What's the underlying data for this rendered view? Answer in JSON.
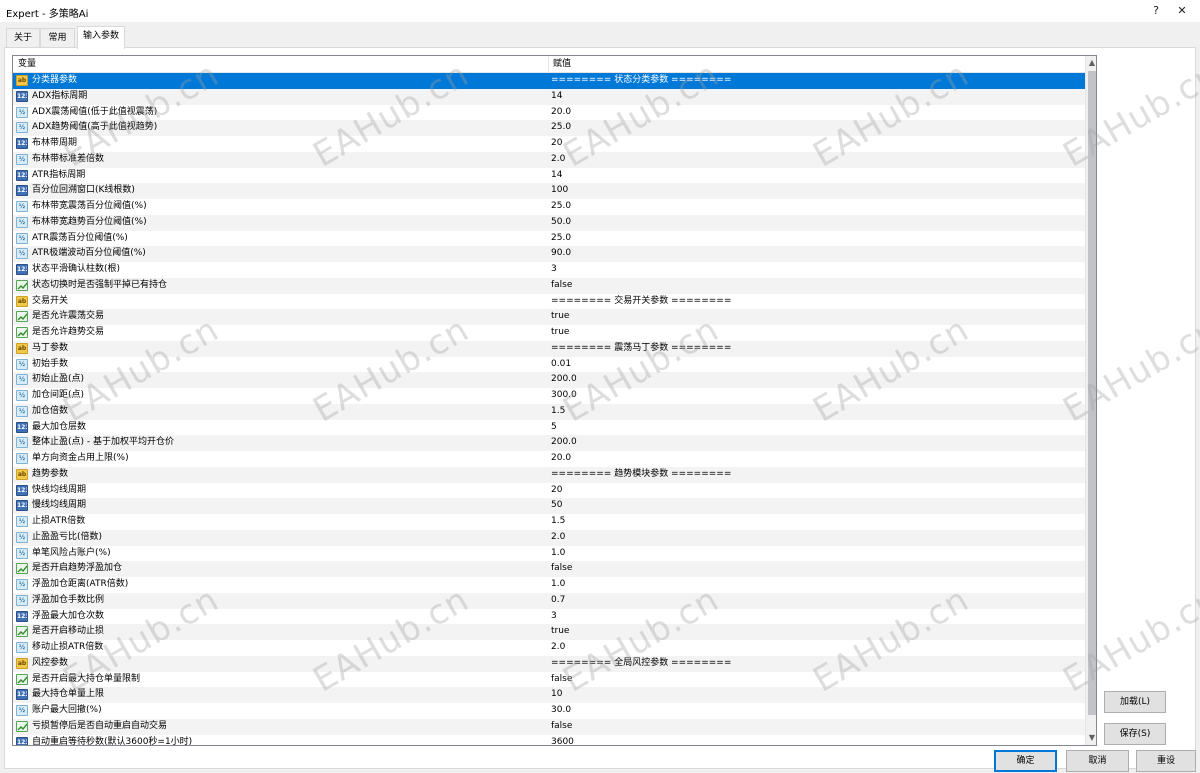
{
  "window": {
    "title": "Expert - 多策略Ai",
    "help_label": "?",
    "close_label": "✕"
  },
  "tabs": [
    {
      "label": "关于",
      "active": false
    },
    {
      "label": "常用",
      "active": false
    },
    {
      "label": "输入参数",
      "active": true
    }
  ],
  "table": {
    "col_variable": "变量",
    "col_value": "赋值",
    "rows": [
      {
        "type": "string",
        "name": "分类器参数",
        "value": "======== 状态分类参数 ========",
        "selected": true
      },
      {
        "type": "int",
        "name": "ADX指标周期",
        "value": "14"
      },
      {
        "type": "double",
        "name": "ADX震荡阈值(低于此值视震荡)",
        "value": "20.0"
      },
      {
        "type": "double",
        "name": "ADX趋势阈值(高于此值视趋势)",
        "value": "25.0"
      },
      {
        "type": "int",
        "name": "布林带周期",
        "value": "20"
      },
      {
        "type": "double",
        "name": "布林带标准差倍数",
        "value": "2.0"
      },
      {
        "type": "int",
        "name": "ATR指标周期",
        "value": "14"
      },
      {
        "type": "int",
        "name": "百分位回溯窗口(K线根数)",
        "value": "100"
      },
      {
        "type": "double",
        "name": "布林带宽震荡百分位阈值(%)",
        "value": "25.0"
      },
      {
        "type": "double",
        "name": "布林带宽趋势百分位阈值(%)",
        "value": "50.0"
      },
      {
        "type": "double",
        "name": "ATR震荡百分位阈值(%)",
        "value": "25.0"
      },
      {
        "type": "double",
        "name": "ATR极端波动百分位阈值(%)",
        "value": "90.0"
      },
      {
        "type": "int",
        "name": "状态平滑确认柱数(根)",
        "value": "3"
      },
      {
        "type": "bool",
        "name": "状态切换时是否强制平掉已有持仓",
        "value": "false"
      },
      {
        "type": "string",
        "name": "交易开关",
        "value": "======== 交易开关参数 ========"
      },
      {
        "type": "bool",
        "name": "是否允许震荡交易",
        "value": "true"
      },
      {
        "type": "bool",
        "name": "是否允许趋势交易",
        "value": "true"
      },
      {
        "type": "string",
        "name": "马丁参数",
        "value": "======== 震荡马丁参数 ========"
      },
      {
        "type": "double",
        "name": "初始手数",
        "value": "0.01"
      },
      {
        "type": "double",
        "name": "初始止盈(点)",
        "value": "200.0"
      },
      {
        "type": "double",
        "name": "加仓间距(点)",
        "value": "300.0"
      },
      {
        "type": "double",
        "name": "加仓倍数",
        "value": "1.5"
      },
      {
        "type": "int",
        "name": "最大加仓层数",
        "value": "5"
      },
      {
        "type": "double",
        "name": "整体止盈(点) - 基于加权平均开仓价",
        "value": "200.0"
      },
      {
        "type": "double",
        "name": "单方向资金占用上限(%)",
        "value": "20.0"
      },
      {
        "type": "string",
        "name": "趋势参数",
        "value": "======== 趋势模块参数 ========"
      },
      {
        "type": "int",
        "name": "快线均线周期",
        "value": "20"
      },
      {
        "type": "int",
        "name": "慢线均线周期",
        "value": "50"
      },
      {
        "type": "double",
        "name": "止损ATR倍数",
        "value": "1.5"
      },
      {
        "type": "double",
        "name": "止盈盈亏比(倍数)",
        "value": "2.0"
      },
      {
        "type": "double",
        "name": "单笔风险占账户(%)",
        "value": "1.0"
      },
      {
        "type": "bool",
        "name": "是否开启趋势浮盈加仓",
        "value": "false"
      },
      {
        "type": "double",
        "name": "浮盈加仓距离(ATR倍数)",
        "value": "1.0"
      },
      {
        "type": "double",
        "name": "浮盈加仓手数比例",
        "value": "0.7"
      },
      {
        "type": "int",
        "name": "浮盈最大加仓次数",
        "value": "3"
      },
      {
        "type": "bool",
        "name": "是否开启移动止损",
        "value": "true"
      },
      {
        "type": "double",
        "name": "移动止损ATR倍数",
        "value": "2.0"
      },
      {
        "type": "string",
        "name": "风控参数",
        "value": "======== 全局风控参数 ========"
      },
      {
        "type": "bool",
        "name": "是否开启最大持仓单量限制",
        "value": "false"
      },
      {
        "type": "int",
        "name": "最大持仓单量上限",
        "value": "10"
      },
      {
        "type": "double",
        "name": "账户最大回撤(%)",
        "value": "30.0"
      },
      {
        "type": "bool",
        "name": "亏损暂停后是否自动重启自动交易",
        "value": "false"
      },
      {
        "type": "int",
        "name": "自动重启等待秒数(默认3600秒=1小时)",
        "value": "3600"
      }
    ]
  },
  "buttons": {
    "load": "加载(L)",
    "save": "保存(S)",
    "ok": "确定",
    "cancel": "取消",
    "reset": "重设"
  },
  "icon_labels": {
    "string": "ab",
    "int": "123",
    "double": "½"
  },
  "watermark": "EAHub.cn",
  "colors": {
    "selection": "#0078d7",
    "row_alt": "#f3f3f3"
  }
}
